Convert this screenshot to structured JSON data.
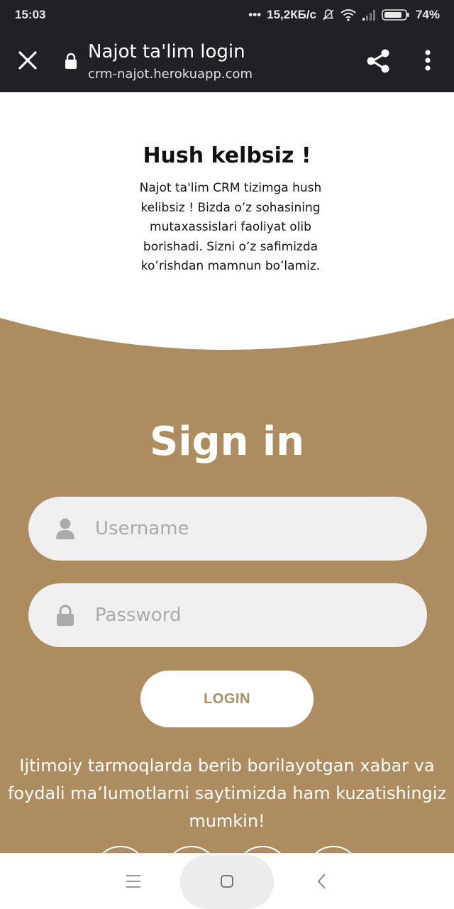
{
  "status_bar": {
    "time": "15:03",
    "dots": "•••",
    "network_speed": "15,2КБ/с",
    "battery": "74%"
  },
  "browser": {
    "title": "Najot ta'lim login",
    "url": "crm-najot.herokuapp.com",
    "icons": [
      "close-icon",
      "lock-icon",
      "share-icon",
      "more-vertical-icon"
    ]
  },
  "welcome": {
    "title": "Hush kelbsiz !",
    "text": "Najot ta'lim CRM tizimga hush kelibsiz ! Bizda o’z sohasining mutaxassislari faoliyat olib borishadi. Sizni o’z safimizda ko’rishdan mamnun bo’lamiz."
  },
  "signin": {
    "title": "Sign in",
    "username_placeholder": "Username",
    "password_placeholder": "Password",
    "login_label": "LOGIN",
    "social_text": "Ijtimoiy tarmoqlarda berib borilayotgan xabar va foydali ma’lumotlarni saytimizda ham kuzatishingiz mumkin!"
  },
  "colors": {
    "brand": "#ad8d5f",
    "browser_bar": "#202124",
    "field_bg": "#f0f0f0"
  },
  "nav_bar": {
    "icons": [
      "menu-icon",
      "home-icon",
      "back-icon"
    ]
  }
}
